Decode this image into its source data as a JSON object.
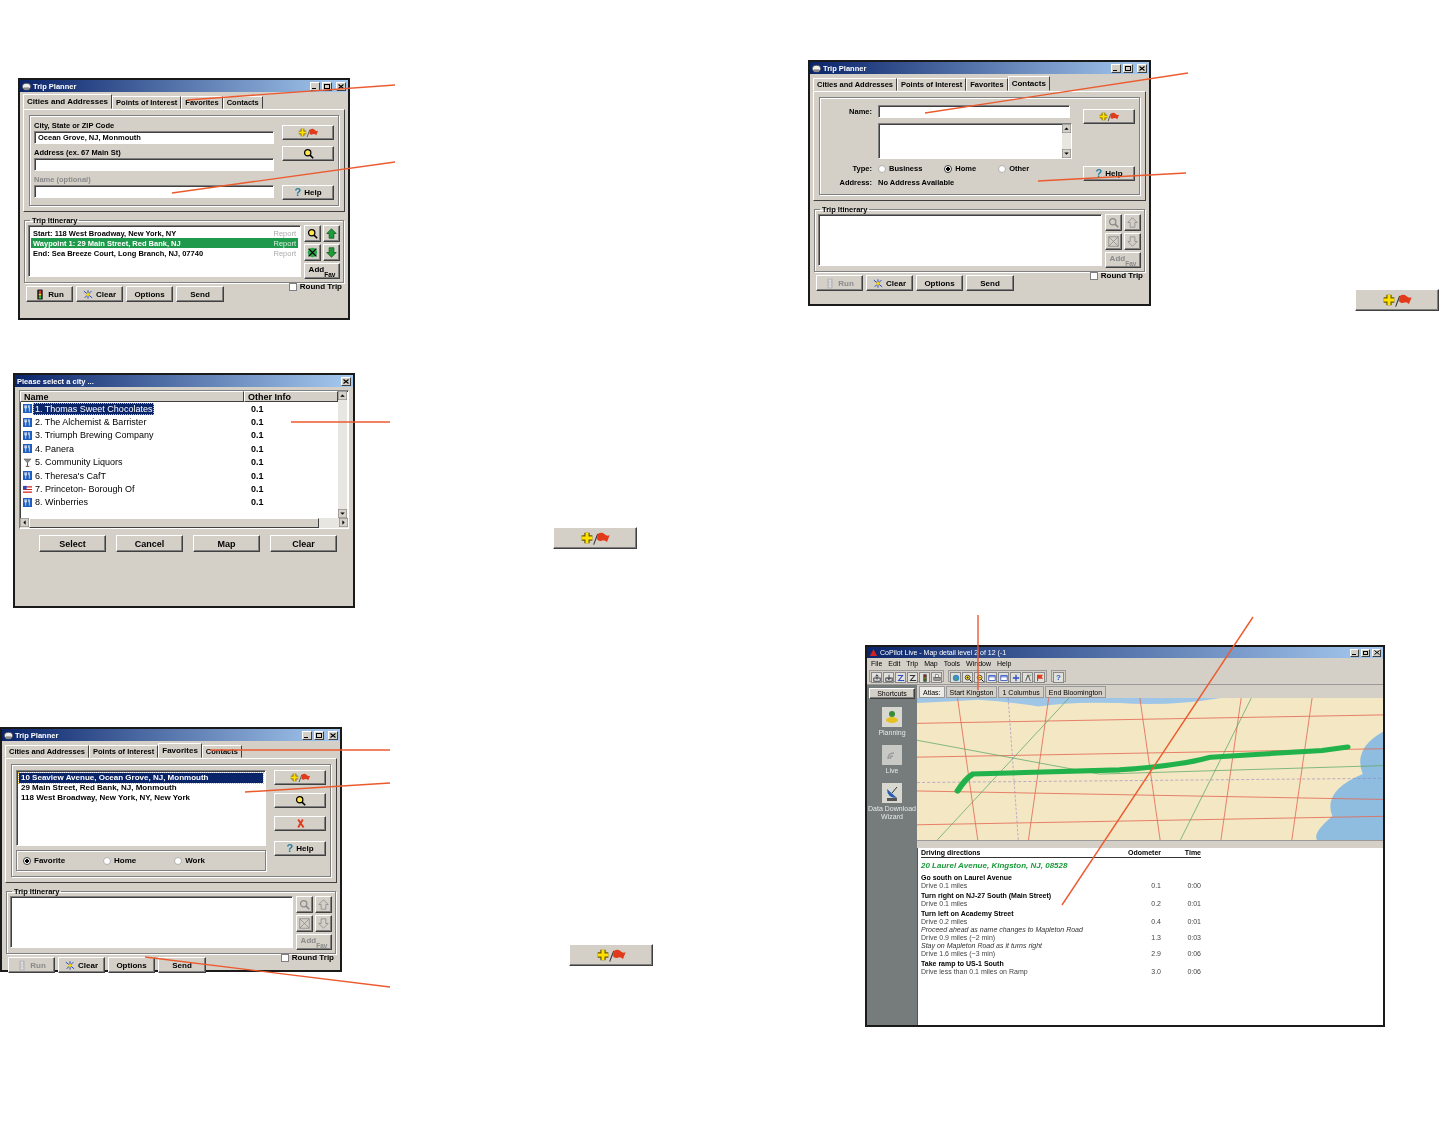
{
  "planner_cities": {
    "title": "Trip Planner",
    "tabs": [
      {
        "label": "Cities and Addresses",
        "selected": true
      },
      {
        "label": "Points of Interest",
        "selected": false
      },
      {
        "label": "Favorites",
        "selected": false
      },
      {
        "label": "Contacts",
        "selected": false
      }
    ],
    "fields": [
      {
        "label": "City, State or ZIP Code",
        "value": "Ocean Grove, NJ, Monmouth",
        "disabled": false
      },
      {
        "label": "Address (ex. 67 Main St)",
        "disabled": false
      },
      {
        "label": "Name (optional)",
        "disabled": true
      }
    ],
    "side_buttons": [
      {
        "kind": "add_favorite"
      },
      {
        "kind": "zoom"
      },
      {
        "kind": "help",
        "icon": "?",
        "label": "Help"
      }
    ],
    "itinerary": {
      "title": "Trip Itinerary",
      "tools_disabled": false,
      "add_label": "Add",
      "fav_label": "Fav",
      "rows": [
        {
          "text": "Start: 118 West Broadway, New York, NY",
          "report": "Report",
          "selected": false
        },
        {
          "text": "Waypoint 1: 29 Main Street, Red Bank, NJ",
          "report": "Report",
          "selected": true
        },
        {
          "text": "End: Sea Breeze Court, Long Branch, NJ, 07740",
          "report": "Report",
          "selected": false
        }
      ]
    },
    "round_trip": {
      "label": "Round Trip",
      "checked": false
    },
    "buttons": [
      {
        "kind": "run",
        "label": "Run",
        "disabled": false
      },
      {
        "kind": "clear",
        "label": "Clear",
        "disabled": false
      },
      {
        "kind": "plain",
        "label": "Options",
        "disabled": false
      },
      {
        "kind": "plain",
        "label": "Send",
        "disabled": false
      }
    ]
  },
  "planner_contacts": {
    "title": "Trip Planner",
    "tabs": [
      {
        "label": "Cities and Addresses",
        "selected": false
      },
      {
        "label": "Points of Interest",
        "selected": false
      },
      {
        "label": "Favorites",
        "selected": false
      },
      {
        "label": "Contacts",
        "selected": true
      }
    ],
    "name_label": "Name:",
    "type_label": "Type:",
    "types": [
      {
        "label": "Business",
        "selected": false
      },
      {
        "label": "Home",
        "selected": true
      },
      {
        "label": "Other",
        "selected": false
      }
    ],
    "address_label": "Address:",
    "address_value": "No Address Available",
    "side_buttons": [
      {
        "kind": "add_favorite"
      },
      {
        "kind": "help",
        "icon": "?",
        "label": "Help"
      }
    ],
    "itinerary": {
      "title": "Trip Itinerary",
      "tools_disabled": true,
      "add_label": "Add",
      "fav_label": "Fav"
    },
    "round_trip": {
      "label": "Round Trip",
      "checked": false
    },
    "buttons": [
      {
        "kind": "run",
        "label": "Run",
        "disabled": true
      },
      {
        "kind": "clear",
        "label": "Clear",
        "disabled": false
      },
      {
        "kind": "plain",
        "label": "Options",
        "disabled": false
      },
      {
        "kind": "plain",
        "label": "Send",
        "disabled": false
      }
    ]
  },
  "city_picker": {
    "title": "Please select a city ...",
    "columns": [
      "Name",
      "Other Info"
    ],
    "rows": [
      {
        "kind": "restaurant",
        "text": "1. Thomas Sweet Chocolates",
        "info": "0.1",
        "selected": true
      },
      {
        "kind": "restaurant",
        "text": "2. The Alchemist & Barrister",
        "info": "0.1",
        "selected": false
      },
      {
        "kind": "restaurant",
        "text": "3. Triumph Brewing Company",
        "info": "0.1",
        "selected": false
      },
      {
        "kind": "restaurant",
        "text": "4. Panera",
        "info": "0.1",
        "selected": false
      },
      {
        "kind": "bar",
        "text": "5. Community Liquors",
        "info": "0.1",
        "selected": false
      },
      {
        "kind": "restaurant",
        "text": "6. Theresa's CafT",
        "info": "0.1",
        "selected": false
      },
      {
        "kind": "flag",
        "text": "7. Princeton- Borough Of",
        "info": "0.1",
        "selected": false
      },
      {
        "kind": "restaurant",
        "text": "8. Winberries",
        "info": "0.1",
        "selected": false
      }
    ],
    "buttons": [
      "Select",
      "Cancel",
      "Map",
      "Clear"
    ]
  },
  "planner_favorites": {
    "title": "Trip Planner",
    "tabs": [
      {
        "label": "Cities and Addresses",
        "selected": false
      },
      {
        "label": "Points of Interest",
        "selected": false
      },
      {
        "label": "Favorites",
        "selected": true
      },
      {
        "label": "Contacts",
        "selected": false
      }
    ],
    "favorites": [
      {
        "text": "10 Seaview Avenue, Ocean Grove, NJ, Monmouth",
        "selected": true
      },
      {
        "text": "29 Main Street, Red Bank, NJ, Monmouth",
        "selected": false
      },
      {
        "text": "118 West Broadway, New York, NY, New York",
        "selected": false
      }
    ],
    "categories": [
      {
        "label": "Favorite",
        "selected": true
      },
      {
        "label": "Home",
        "selected": false
      },
      {
        "label": "Work",
        "selected": false
      }
    ],
    "side_buttons": [
      {
        "kind": "add_favorite"
      },
      {
        "kind": "zoom"
      },
      {
        "kind": "delete"
      },
      {
        "kind": "help",
        "icon": "?",
        "label": "Help"
      }
    ],
    "itinerary": {
      "title": "Trip Itinerary",
      "tools_disabled": true,
      "add_label": "Add",
      "fav_label": "Fav"
    },
    "round_trip": {
      "label": "Round Trip",
      "checked": false
    },
    "buttons": [
      {
        "kind": "run",
        "label": "Run",
        "disabled": true
      },
      {
        "kind": "clear",
        "label": "Clear",
        "disabled": false
      },
      {
        "kind": "plain",
        "label": "Options",
        "disabled": false
      },
      {
        "kind": "plain",
        "label": "Send",
        "disabled": false
      }
    ]
  },
  "map_window": {
    "title": "CoPilot Live - Map detail level 2 of 12 (-1",
    "menu": [
      "File",
      "Edit",
      "Trip",
      "Map",
      "Tools",
      "Window",
      "Help"
    ],
    "help_glyph": "?",
    "shortcuts": "Shortcuts",
    "shortcut_items": [
      {
        "kind": "planning",
        "label": "Planning"
      },
      {
        "kind": "live",
        "label": "Live"
      },
      {
        "kind": "download",
        "label": "Data Download Wizard"
      }
    ],
    "tabs": [
      {
        "label": "Atlas:",
        "selected": true
      },
      {
        "label": "Start Kingston",
        "selected": false
      },
      {
        "label": "1 Columbus",
        "selected": false
      },
      {
        "label": "End Bloomington",
        "selected": false
      }
    ],
    "directions": {
      "columns": [
        "Driving directions",
        "Odometer",
        "Time"
      ],
      "origin": "20 Laurel Avenue, Kingston, NJ, 08528",
      "steps": [
        {
          "title": "Go south on Laurel Avenue",
          "rows": [
            {
              "kind": "drive",
              "text": "Drive 0.1 miles",
              "odometer": "0.1",
              "time": "0:00"
            }
          ]
        },
        {
          "title": "Turn right on NJ-27 South (Main Street)",
          "rows": [
            {
              "kind": "drive",
              "text": "Drive 0.1 miles",
              "odometer": "0.2",
              "time": "0:01"
            }
          ]
        },
        {
          "title": "Turn left on Academy Street",
          "rows": [
            {
              "kind": "drive",
              "text": "Drive 0.2 miles",
              "odometer": "0.4",
              "time": "0:01"
            },
            {
              "kind": "note",
              "text": "Proceed ahead as name changes to Mapleton Road"
            },
            {
              "kind": "drive",
              "text": "Drive 0.9 miles (~2 min)",
              "odometer": "1.3",
              "time": "0:03"
            },
            {
              "kind": "note",
              "text": "Stay on Mapleton Road as it turns right"
            },
            {
              "kind": "drive",
              "text": "Drive 1.6 miles (~3 min)",
              "odometer": "2.9",
              "time": "0:06"
            }
          ]
        },
        {
          "title": "Take ramp to US-1 South",
          "rows": [
            {
              "kind": "drive",
              "text": "Drive less than 0.1 miles on Ramp",
              "odometer": "3.0",
              "time": "0:06"
            }
          ]
        }
      ]
    }
  },
  "loose_buttons": [
    {
      "kind": "add_favorite"
    },
    {
      "kind": "add_favorite"
    },
    {
      "kind": "add_favorite"
    }
  ]
}
